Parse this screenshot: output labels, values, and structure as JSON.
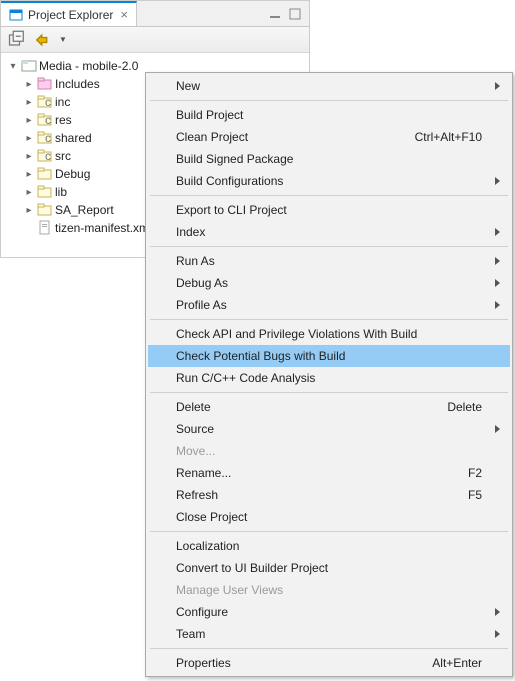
{
  "tab": {
    "title": "Project Explorer"
  },
  "tree": {
    "root": {
      "label": "Media - mobile-2.0"
    },
    "children": [
      {
        "label": "Includes",
        "kind": "includes"
      },
      {
        "label": "inc",
        "kind": "cfolder"
      },
      {
        "label": "res",
        "kind": "cfolder"
      },
      {
        "label": "shared",
        "kind": "cfolder"
      },
      {
        "label": "src",
        "kind": "cfolder"
      },
      {
        "label": "Debug",
        "kind": "folder"
      },
      {
        "label": "lib",
        "kind": "folder"
      },
      {
        "label": "SA_Report",
        "kind": "folder"
      },
      {
        "label": "tizen-manifest.xml",
        "kind": "file"
      }
    ]
  },
  "menu": {
    "items": {
      "new": "New",
      "build_project": "Build Project",
      "clean_project": "Clean Project",
      "clean_project_shortcut": "Ctrl+Alt+F10",
      "build_signed": "Build Signed Package",
      "build_configs": "Build Configurations",
      "export_cli": "Export to CLI Project",
      "index": "Index",
      "run_as": "Run As",
      "debug_as": "Debug As",
      "profile_as": "Profile As",
      "check_api": "Check API and Privilege Violations With Build",
      "check_bugs": "Check Potential Bugs with Build",
      "run_analysis": "Run C/C++ Code Analysis",
      "delete": "Delete",
      "delete_shortcut": "Delete",
      "source": "Source",
      "move": "Move...",
      "rename": "Rename...",
      "rename_shortcut": "F2",
      "refresh": "Refresh",
      "refresh_shortcut": "F5",
      "close_project": "Close Project",
      "localization": "Localization",
      "convert_ui": "Convert to UI Builder Project",
      "manage_views": "Manage User Views",
      "configure": "Configure",
      "team": "Team",
      "properties": "Properties",
      "properties_shortcut": "Alt+Enter"
    }
  }
}
